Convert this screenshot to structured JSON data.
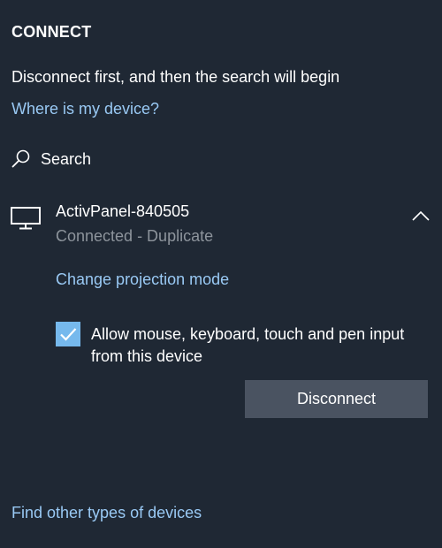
{
  "panel": {
    "title": "CONNECT",
    "status_message": "Disconnect first, and then the search will begin",
    "where_link": "Where is my device?",
    "search_label": "Search",
    "search_icon": "search-icon",
    "footer_link": "Find other types of devices"
  },
  "device": {
    "icon": "monitor-icon",
    "name": "ActivPanel-840505",
    "status": "Connected - Duplicate",
    "expanded": true,
    "change_mode_link": "Change projection mode",
    "allow_input_checked": true,
    "allow_input_label": "Allow mouse, keyboard, touch and pen input from this device",
    "disconnect_label": "Disconnect"
  },
  "colors": {
    "background": "#1f2834",
    "link": "#99c9f4",
    "secondary_text": "#8d949c",
    "checkbox_fill": "#76b9ed",
    "button_bg": "#4a5361"
  }
}
